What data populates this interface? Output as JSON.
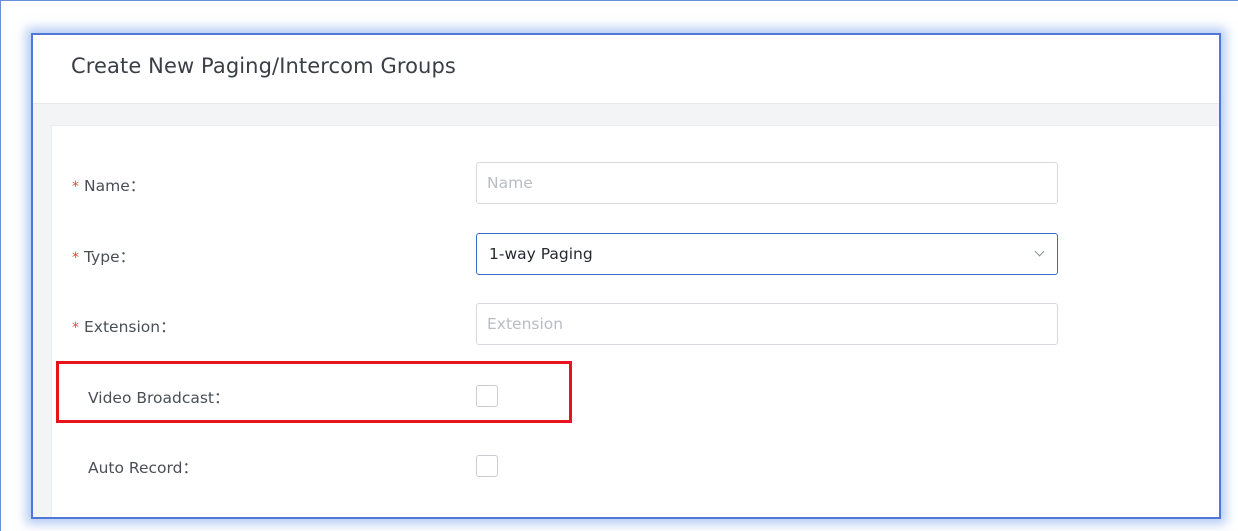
{
  "dialog": {
    "title": "Create New Paging/Intercom Groups"
  },
  "form": {
    "required_mark": "*",
    "name": {
      "label": "Name：",
      "placeholder": "Name",
      "value": ""
    },
    "type": {
      "label": "Type：",
      "selected": "1-way Paging"
    },
    "extension": {
      "label": "Extension：",
      "placeholder": "Extension",
      "value": ""
    },
    "video_broadcast": {
      "label": "Video Broadcast：",
      "checked": false
    },
    "auto_record": {
      "label": "Auto Record：",
      "checked": false
    }
  },
  "annotation": {
    "highlight_color": "#e8131b"
  },
  "colors": {
    "accent": "#4f78d6",
    "required": "#e64a3b"
  }
}
